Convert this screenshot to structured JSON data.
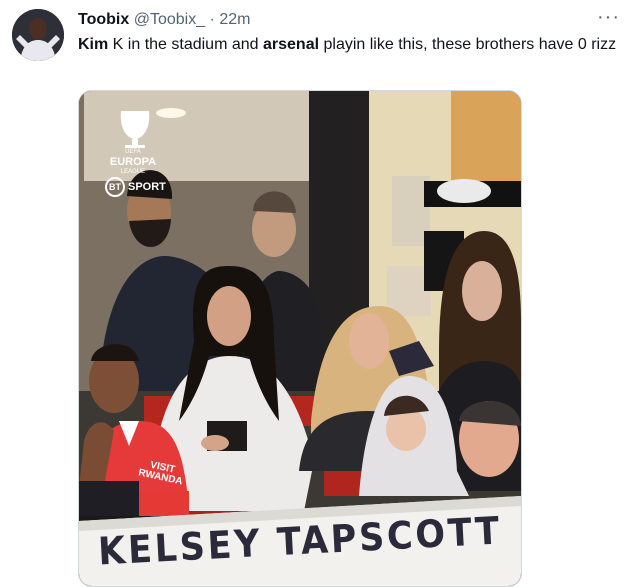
{
  "author": {
    "display_name": "Toobix",
    "handle": "@Toobix_",
    "separator": "·",
    "time": "22m"
  },
  "more_label": "···",
  "text": {
    "part1": "Kim",
    "part2": " K in the stadium and ",
    "part3": "arsenal",
    "part4": " playin like this, these brothers have 0 rizz"
  },
  "media": {
    "uel_line1": "UEFA",
    "uel_line2": "EUROPA",
    "uel_line3": "LEAGUE",
    "bt_mark": "BT",
    "bt_label": "SPORT",
    "shirt_text_1": "VISIT",
    "shirt_text_2": "RWANDA",
    "banner_text": "KELSEY TAPSCOTT"
  },
  "colors": {
    "text": "#0f1419",
    "secondary": "#536471",
    "border": "#cfd9de"
  }
}
